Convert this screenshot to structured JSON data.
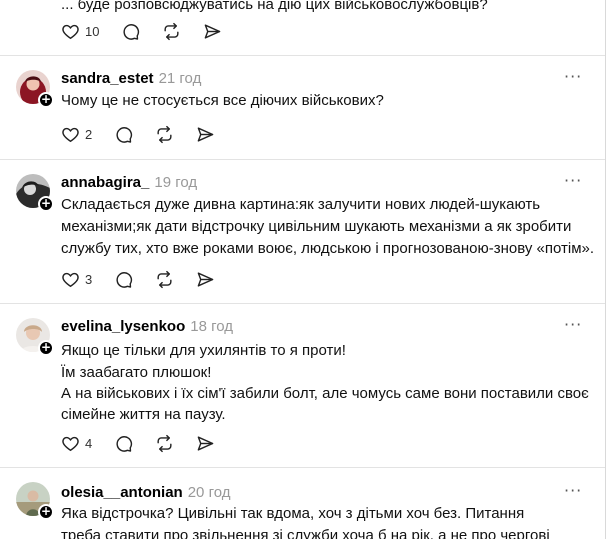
{
  "top_post": {
    "partial_text": "... буде розповсюджуватись на дію цих військовослужбовців?",
    "likes": "10"
  },
  "posts": [
    {
      "username": "sandra_estet",
      "time": "21 год",
      "lines": [
        "Чому це не стосується все діючих військових?"
      ],
      "likes": "2"
    },
    {
      "username": "annabagira_",
      "time": "19 год",
      "lines": [
        "Складається дуже дивна картина:як залучити нових людей-шукають",
        "механізми;як дати відстрочку цивільним шукають механізми а як зробити",
        "службу тих, хто вже роками воює, людською і прогнозованою-знову «потім»."
      ],
      "likes": "3"
    },
    {
      "username": "evelina_lysenkoo",
      "time": "18 год",
      "lines": [
        "Якщо це тільки для ухилянтів то я проти!",
        "Їм заабагато плюшок!",
        "А на військових і їх сім'ї забили болт, але чомусь саме вони поставили своє",
        "сімейне життя на паузу."
      ],
      "likes": "4"
    },
    {
      "username": "olesia__antonian",
      "time": "20 год",
      "lines": [
        "Яка відстрочка? Цивільні так вдома, хоч з дітьми хоч без. Питання",
        "треба ставити про звільнення зі служби хоча б на рік, а не про чергові"
      ],
      "likes": ""
    }
  ],
  "icons": {
    "like": "heart-icon",
    "reply": "comment-icon",
    "repost": "repost-icon",
    "share": "send-icon",
    "more": "more-dots-icon",
    "follow": "plus-icon"
  }
}
